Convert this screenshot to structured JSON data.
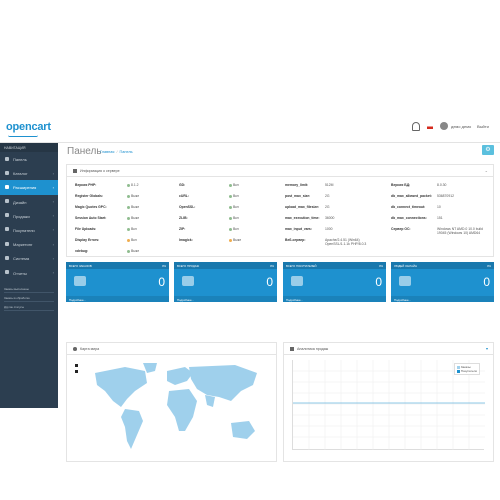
{
  "header": {
    "logo_text": "opencart",
    "user_name": "демо демо",
    "logout_label": "Выйти"
  },
  "sidebar": {
    "nav_title": "НАВИГАЦИЯ",
    "items": [
      {
        "label": "Панель",
        "icon": "dashboard-icon",
        "has_children": false,
        "active": false
      },
      {
        "label": "Каталог",
        "icon": "tag-icon",
        "has_children": true,
        "active": false
      },
      {
        "label": "Расширения",
        "icon": "puzzle-icon",
        "has_children": true,
        "active": true
      },
      {
        "label": "Дизайн",
        "icon": "desktop-icon",
        "has_children": true,
        "active": false
      },
      {
        "label": "Продажи",
        "icon": "cart-icon",
        "has_children": true,
        "active": false
      },
      {
        "label": "Покупатели",
        "icon": "user-icon",
        "has_children": true,
        "active": false
      },
      {
        "label": "Маркетинг",
        "icon": "share-icon",
        "has_children": true,
        "active": false
      },
      {
        "label": "Система",
        "icon": "cog-icon",
        "has_children": true,
        "active": false
      },
      {
        "label": "Отчеты",
        "icon": "bar-chart-icon",
        "has_children": true,
        "active": false
      }
    ],
    "progress": [
      {
        "label": "Заказы выполнены",
        "percent": 0
      },
      {
        "label": "Заказы в обработке",
        "percent": 0
      },
      {
        "label": "Другие статусы",
        "percent": 0
      }
    ]
  },
  "page": {
    "title": "Панель",
    "breadcrumb_home": "Главная",
    "breadcrumb_current": "Панель"
  },
  "info_panel": {
    "title": "Информация о сервере",
    "col1": [
      {
        "label": "Версия PHP:",
        "value": "8.1.2",
        "status": "on"
      },
      {
        "label": "Register Globals:",
        "value": "Выкл",
        "status": "on"
      },
      {
        "label": "Magic Quotes GPC:",
        "value": "Выкл",
        "status": "on"
      },
      {
        "label": "Session Auto Start:",
        "value": "Выкл",
        "status": "on"
      },
      {
        "label": "File Uploads:",
        "value": "Вкл",
        "status": "on"
      },
      {
        "label": "Display Errors:",
        "value": "Вкл",
        "status": "off"
      },
      {
        "label": "xdebug:",
        "value": "Выкл",
        "status": "on"
      }
    ],
    "col2": [
      {
        "label": "GD:",
        "value": "Вкл",
        "status": "on"
      },
      {
        "label": "cURL:",
        "value": "Вкл",
        "status": "on"
      },
      {
        "label": "OpenSSL:",
        "value": "Вкл",
        "status": "on"
      },
      {
        "label": "ZLIB:",
        "value": "Вкл",
        "status": "on"
      },
      {
        "label": "ZIP:",
        "value": "Вкл",
        "status": "on"
      },
      {
        "label": "Imagick:",
        "value": "Выкл",
        "status": "off"
      }
    ],
    "col3": [
      {
        "label": "memory_limit:",
        "value": "512M"
      },
      {
        "label": "post_max_size:",
        "value": "2G"
      },
      {
        "label": "upload_max_filesize:",
        "value": "2G"
      },
      {
        "label": "max_execution_time:",
        "value": "36000"
      },
      {
        "label": "max_input_vars:",
        "value": "1000"
      },
      {
        "label": "Веб-сервер:",
        "value": "Apache/2.4.51 (Win64) OpenSSL/1.1.1k PHP/8.0.3"
      }
    ],
    "col4": [
      {
        "label": "Версия БД:",
        "value": "8.0.30"
      },
      {
        "label": "db_max_allowed_packet:",
        "value": "536870912"
      },
      {
        "label": "db_connect_timeout:",
        "value": "10"
      },
      {
        "label": "db_max_connections:",
        "value": "151"
      },
      {
        "label": "Сервер ОС:",
        "value": "Windows NT AMD.0 10.0 build 19045 (Windows 10) AMD64"
      }
    ]
  },
  "tiles": [
    {
      "title": "ВСЕГО ЗАКАЗОВ",
      "percent": "0%",
      "value": "0",
      "footer": "Подробнее...",
      "icon": "cart-icon"
    },
    {
      "title": "ВСЕГО ПРОДАЖ",
      "percent": "0%",
      "value": "0",
      "footer": "Подробнее...",
      "icon": "credit-card-icon"
    },
    {
      "title": "ВСЕГО ПОКУПАТЕЛЕЙ",
      "percent": "0%",
      "value": "0",
      "footer": "Подробнее...",
      "icon": "user-icon"
    },
    {
      "title": "ЛЮДЕЙ ОНЛАЙН",
      "percent": "0%",
      "value": "0",
      "footer": "Подробнее...",
      "icon": "users-icon"
    }
  ],
  "map_panel": {
    "title": "Карта мира"
  },
  "chart_panel": {
    "title": "Аналитика продаж",
    "legend": [
      "Заказы",
      "Покупатели"
    ]
  },
  "colors": {
    "accent": "#1e91cf",
    "sidebar": "#2c3e50",
    "map_land": "#9fd0ec",
    "chart_line": "#1e91cf"
  }
}
